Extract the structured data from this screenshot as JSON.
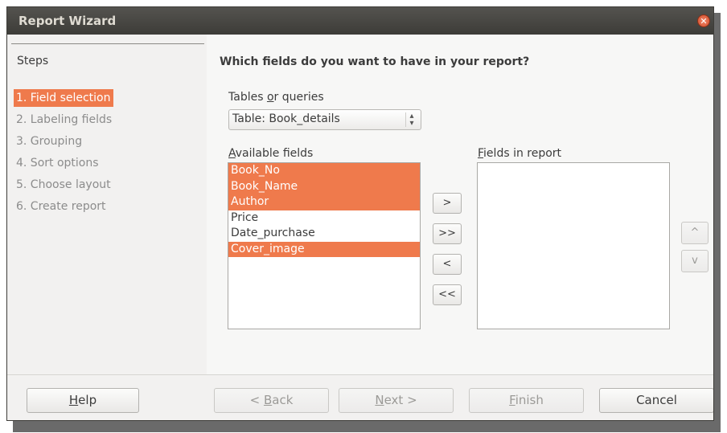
{
  "window": {
    "title": "Report Wizard"
  },
  "steps": {
    "title": "Steps",
    "items": [
      {
        "label": "1. Field selection",
        "active": true
      },
      {
        "label": "2. Labeling fields",
        "active": false
      },
      {
        "label": "3. Grouping",
        "active": false
      },
      {
        "label": "4. Sort options",
        "active": false
      },
      {
        "label": "5. Choose layout",
        "active": false
      },
      {
        "label": "6. Create report",
        "active": false
      }
    ]
  },
  "main": {
    "question": "Which fields do you want to have in your report?",
    "tables_label_pre": "Tables ",
    "tables_label_accel": "o",
    "tables_label_post": "r queries",
    "table_select_value": "Table: Book_details",
    "available_label_accel": "A",
    "available_label_post": "vailable fields",
    "report_label_accel": "F",
    "report_label_post": "ields in report",
    "available_fields": [
      {
        "label": "Book_No",
        "selected": true
      },
      {
        "label": "Book_Name",
        "selected": true
      },
      {
        "label": "Author",
        "selected": true
      },
      {
        "label": "Price",
        "selected": false
      },
      {
        "label": "Date_purchase",
        "selected": false
      },
      {
        "label": "Cover_image",
        "selected": true
      }
    ],
    "report_fields": [],
    "move_buttons": {
      "add": ">",
      "add_all": ">>",
      "remove": "<",
      "remove_all": "<<"
    },
    "order_buttons": {
      "up": "^",
      "down": "v"
    }
  },
  "footer": {
    "help_accel": "H",
    "help_post": "elp",
    "back_pre": "< ",
    "back_accel": "B",
    "back_post": "ack",
    "next_accel": "N",
    "next_post": "ext >",
    "finish_accel": "F",
    "finish_post": "inish",
    "cancel": "Cancel"
  },
  "colors": {
    "accent": "#ef7a4c",
    "titlebar": "#3d3c38"
  }
}
